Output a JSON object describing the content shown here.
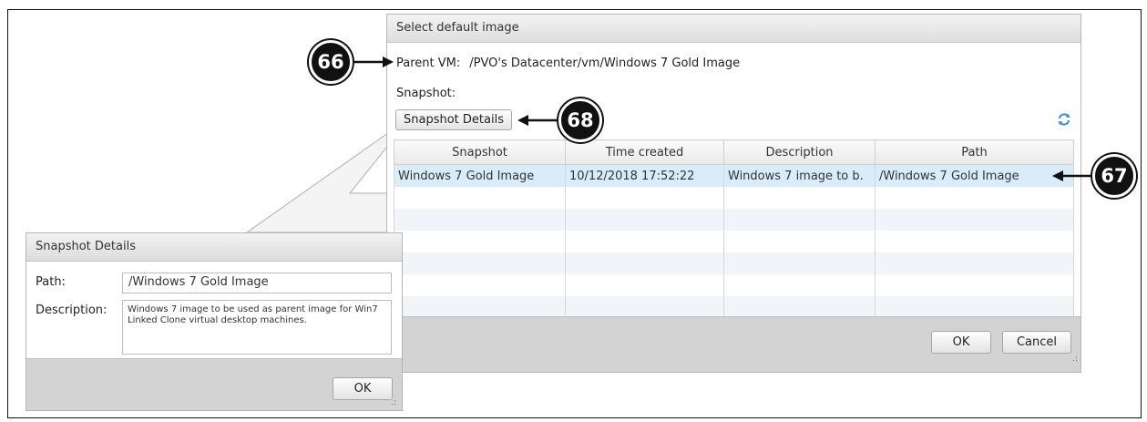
{
  "main_dialog": {
    "title": "Select default image",
    "parent_vm_label": "Parent VM:",
    "parent_vm_value": "/PVO's Datacenter/vm/Windows 7 Gold Image",
    "snapshot_label": "Snapshot:",
    "snapshot_details_button": "Snapshot Details",
    "refresh_icon": "refresh-icon",
    "table": {
      "columns": [
        "Snapshot",
        "Time created",
        "Description",
        "Path"
      ],
      "rows": [
        {
          "snapshot": "Windows 7 Gold Image",
          "time_created": "10/12/2018 17:52:22",
          "description": "Windows 7 image to b.",
          "path": "/Windows 7 Gold Image"
        }
      ]
    },
    "ok_button": "OK",
    "cancel_button": "Cancel"
  },
  "details_dialog": {
    "title": "Snapshot Details",
    "path_label": "Path:",
    "path_value": "/Windows 7 Gold Image",
    "description_label": "Description:",
    "description_value": "Windows 7 image to be used as parent image for Win7 Linked Clone virtual desktop machines.",
    "ok_button": "OK"
  },
  "callouts": {
    "c66": "66",
    "c67": "67",
    "c68": "68"
  },
  "colors": {
    "selected_row": "#d9ecfa",
    "footer": "#d3d3d3",
    "refresh_icon": "#3a8fd6"
  }
}
